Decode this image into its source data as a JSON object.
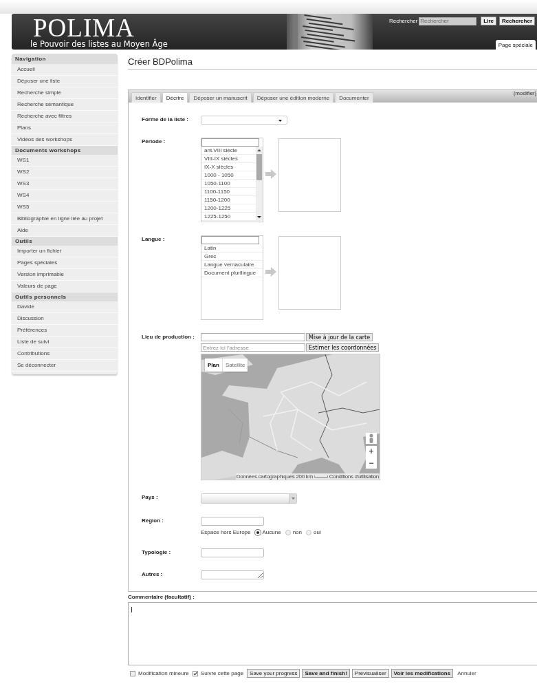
{
  "header": {
    "logo": "POLIMA",
    "subtitle": "le Pouvoir des listes au Moyen Âge",
    "search": {
      "label": "Rechercher",
      "placeholder": "Rechercher",
      "buttons": [
        "Lire",
        "Rechercher"
      ]
    },
    "page_tab": {
      "label": "Page spéciale",
      "selected": true
    }
  },
  "sidebar": {
    "sections": [
      {
        "title": "Navigation",
        "items": [
          "Accueil",
          "Déposer une liste",
          "Recherche simple",
          "Recherche sémantique",
          "Recherche avec filtres",
          "Plans",
          "Vidéos des workshops"
        ]
      },
      {
        "title": "Documents workshops",
        "items": [
          "WS1",
          "WS2",
          "WS3",
          "WS4",
          "WS5",
          "Bibliographie en ligne liée au projet",
          "Aide"
        ]
      },
      {
        "title": "Outils",
        "items": [
          "Importer un fichier",
          "Pages spéciales",
          "Version imprimable",
          "Valeurs de page"
        ]
      },
      {
        "title": "Outils personnels",
        "items": [
          "Davide",
          "Discussion",
          "Préférences",
          "Liste de suivi",
          "Contributions",
          "Se déconnecter"
        ]
      }
    ]
  },
  "page_title": "Créer BDPolima",
  "form": {
    "edit_link": "[modifier]",
    "tabs": [
      {
        "label": "Identifier",
        "selected": false
      },
      {
        "label": "Décrire",
        "selected": true
      },
      {
        "label": "Déposer un manuscrit",
        "selected": false
      },
      {
        "label": "Déposer une édition moderne",
        "selected": false
      },
      {
        "label": "Documenter",
        "selected": false
      }
    ],
    "fields": [
      {
        "kind": "dropdown",
        "label": "Forme de la liste :"
      },
      {
        "kind": "multiselect",
        "label": "Période :",
        "scrollable": true,
        "options": [
          "ant.VIII siècle",
          "VIII-IX siècles",
          "IX-X siècles",
          "1000 - 1050",
          "1050-1100",
          "1100-1150",
          "1150-1200",
          "1200-1225",
          "1225-1250"
        ]
      },
      {
        "kind": "multiselect",
        "label": "Langue :",
        "scrollable": false,
        "options": [
          "Latin",
          "Grec",
          "Langue vernaculaire",
          "Document plurilingue"
        ]
      },
      {
        "kind": "map",
        "label": "Lieu de production :",
        "update_button": "Mise à jour de la carte",
        "address_placeholder": "Entrez ici l'adresse",
        "estimate_button": "Estimer les coordonnées",
        "map": {
          "kind": "picture",
          "map_types": [
            {
              "label": "Plan",
              "selected": true
            },
            {
              "label": "Satellite",
              "selected": false
            }
          ],
          "zoom_in": "+",
          "zoom_out": "−",
          "attribution": "Données cartographiques",
          "scale": "200 km",
          "terms": "Conditions d'utilisation"
        }
      },
      {
        "kind": "combo",
        "label": "Pays :"
      },
      {
        "kind": "region",
        "label": "Région :",
        "radio_label": "Espace hors Europe",
        "options": [
          {
            "label": "Aucune",
            "selected": true
          },
          {
            "label": "non",
            "selected": false
          },
          {
            "label": "oui",
            "selected": false
          }
        ]
      },
      {
        "kind": "text",
        "label": "Typologie :"
      },
      {
        "kind": "textarea",
        "label": "Autres :"
      }
    ]
  },
  "comment": {
    "label": "Commentaire (facultatif) :"
  },
  "footer": {
    "checkboxes": [
      {
        "label": "Modification mineure",
        "checked": false
      },
      {
        "label": "Suivre cette page",
        "checked": true
      }
    ],
    "buttons": [
      {
        "label": "Save your progress",
        "primary": false
      },
      {
        "label": "Save and finish!",
        "primary": true
      },
      {
        "label": "Prévisualiser",
        "primary": false
      },
      {
        "label": "Voir les modifications",
        "primary": true
      }
    ],
    "cancel": "Annuler"
  }
}
